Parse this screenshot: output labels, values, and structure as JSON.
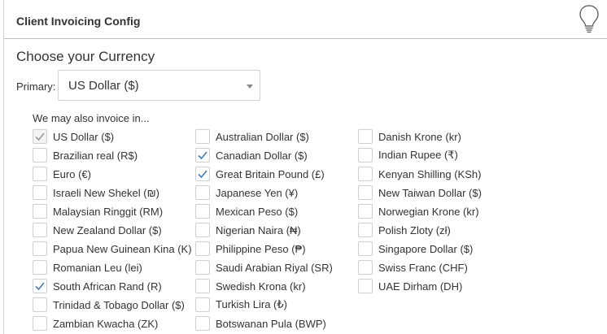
{
  "panel": {
    "title": "Client Invoicing Config",
    "help_icon": "lightbulb-icon"
  },
  "currency": {
    "section_title": "Choose your Currency",
    "primary_label": "Primary:",
    "primary_value": "US Dollar ($)",
    "also_label": "We may also invoice in..."
  },
  "colors": {
    "check_accent": "#3b7dc4",
    "check_disabled": "#9a9a9a"
  },
  "options": [
    {
      "label": "US Dollar ($)",
      "checked": true,
      "disabled": true
    },
    {
      "label": "Brazilian real (R$)",
      "checked": false,
      "disabled": false
    },
    {
      "label": "Euro (€)",
      "checked": false,
      "disabled": false
    },
    {
      "label": "Israeli New Shekel (₪)",
      "checked": false,
      "disabled": false
    },
    {
      "label": "Malaysian Ringgit (RM)",
      "checked": false,
      "disabled": false
    },
    {
      "label": "New Zealand Dollar ($)",
      "checked": false,
      "disabled": false
    },
    {
      "label": "Papua New Guinean Kina (K)",
      "checked": false,
      "disabled": false
    },
    {
      "label": "Romanian Leu (lei)",
      "checked": false,
      "disabled": false
    },
    {
      "label": "South African Rand (R)",
      "checked": true,
      "disabled": false
    },
    {
      "label": "Trinidad & Tobago Dollar ($)",
      "checked": false,
      "disabled": false
    },
    {
      "label": "Zambian Kwacha (ZK)",
      "checked": false,
      "disabled": false
    },
    {
      "label": "Australian Dollar ($)",
      "checked": false,
      "disabled": false
    },
    {
      "label": "Canadian Dollar ($)",
      "checked": true,
      "disabled": false
    },
    {
      "label": "Great Britain Pound (£)",
      "checked": true,
      "disabled": false
    },
    {
      "label": "Japanese Yen (¥)",
      "checked": false,
      "disabled": false
    },
    {
      "label": "Mexican Peso ($)",
      "checked": false,
      "disabled": false
    },
    {
      "label": "Nigerian Naira (₦)",
      "checked": false,
      "disabled": false
    },
    {
      "label": "Philippine Peso (₱)",
      "checked": false,
      "disabled": false
    },
    {
      "label": "Saudi Arabian Riyal (SR)",
      "checked": false,
      "disabled": false
    },
    {
      "label": "Swedish Krona (kr)",
      "checked": false,
      "disabled": false
    },
    {
      "label": "Turkish Lira (₺)",
      "checked": false,
      "disabled": false
    },
    {
      "label": "Botswanan Pula (BWP)",
      "checked": false,
      "disabled": false
    },
    {
      "label": "Danish Krone (kr)",
      "checked": false,
      "disabled": false
    },
    {
      "label": "Indian Rupee (₹)",
      "checked": false,
      "disabled": false
    },
    {
      "label": "Kenyan Shilling (KSh)",
      "checked": false,
      "disabled": false
    },
    {
      "label": "New Taiwan Dollar ($)",
      "checked": false,
      "disabled": false
    },
    {
      "label": "Norwegian Krone (kr)",
      "checked": false,
      "disabled": false
    },
    {
      "label": "Polish Zloty (zł)",
      "checked": false,
      "disabled": false
    },
    {
      "label": "Singapore Dollar ($)",
      "checked": false,
      "disabled": false
    },
    {
      "label": "Swiss Franc (CHF)",
      "checked": false,
      "disabled": false
    },
    {
      "label": "UAE Dirham (DH)",
      "checked": false,
      "disabled": false
    }
  ]
}
